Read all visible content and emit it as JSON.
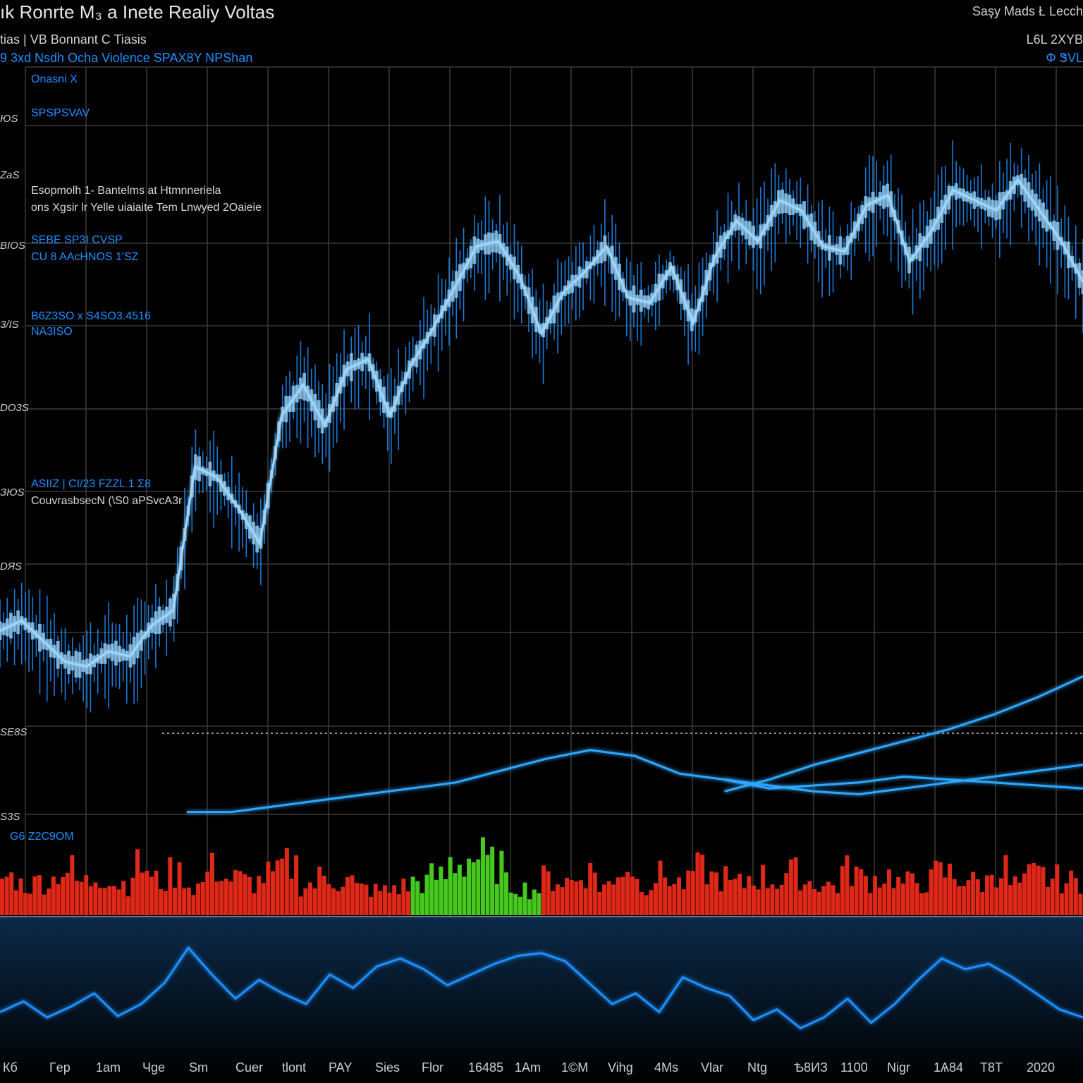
{
  "header": {
    "title": "ık Ronrte M₃ a Inete   Realiy  Voltas",
    "top_right": "Saşy Mads Ł Lecch",
    "line2_left": "tias | VB  Bonnant  C  Tiasis",
    "line2_right": "L6L 2XYB",
    "line3_left": "9 3xd Nsdh Ocha Violence SPAX8Y  NPShan",
    "line3_right": "Φ ᏕVL"
  },
  "annotations": {
    "a1": "Onasni X",
    "a2": "SPSPSVAV",
    "a3_line1": "Esopmolh 1- Bantelms  at  Htmnneriela",
    "a3_line2": "ons Xgsir  lr  Yelle uiaiaite  Tem Lnwyed 2Oaieie",
    "a4_line1": "SEBE  SP3I  CVSP",
    "a4_line2": "CU 8 AAcHNOS  1'SZ",
    "a5_line1": "B6Z3SO  x  S4SO3.4516",
    "a5_line2": "NA3ISO",
    "a6_line1": "ASIIZ  |  CI/23  FZZL  1 Σ8",
    "a6_line2": "CouvrasbsecN (\\S0 aPSvcA3r",
    "a7": "G6  Z2C9OM"
  },
  "y_ticks_left": [
    "ЮS",
    "ZaS",
    "BIOS",
    "3/IS",
    "DO3S",
    "ЗЮS",
    "DЯS",
    "SE8S",
    "S3S"
  ],
  "x_ticks": [
    "Кб",
    "Гep",
    "1am",
    "Чge",
    "Sm",
    "Cuer",
    "tlont",
    "PAY",
    "Sies",
    "Flor",
    "16485",
    "1Am",
    "1©M",
    "Vihg",
    "4Ms",
    "Vlar",
    "Ntg",
    "Ѣ8ИЗ",
    "1100",
    "Nigr",
    "1Ѧ84",
    "T8T",
    "2020"
  ],
  "colors": {
    "background": "#000000",
    "grid": "#3a3a3a",
    "price": "#1e90ff",
    "price_glow": "#9ed8ff",
    "volume_down": "#e02818",
    "volume_up": "#46c81e",
    "indicator": "#2ea8ff",
    "oscillator": "#1e8fff"
  },
  "chart_data": [
    {
      "type": "line",
      "name": "price",
      "x": [
        0,
        1,
        2,
        3,
        4,
        5,
        6,
        7,
        8,
        9,
        10,
        11,
        12,
        13,
        14,
        15,
        16,
        17,
        18,
        19,
        20,
        21,
        22,
        23,
        24,
        25,
        26,
        27,
        28,
        29,
        30,
        31,
        32,
        33,
        34,
        35,
        36,
        37,
        38,
        39,
        40,
        41,
        42,
        43,
        44,
        45,
        46,
        47,
        48,
        49,
        50
      ],
      "values": [
        20,
        22,
        18,
        14,
        13,
        16,
        15,
        21,
        24,
        52,
        50,
        44,
        37,
        62,
        68,
        60,
        71,
        73,
        62,
        72,
        79,
        87,
        95,
        96,
        89,
        78,
        86,
        90,
        95,
        85,
        84,
        91,
        80,
        93,
        100,
        96,
        104,
        102,
        95,
        94,
        103,
        105,
        92,
        98,
        106,
        104,
        102,
        108,
        102,
        96,
        88
      ],
      "ylim": [
        0,
        130
      ]
    },
    {
      "type": "line",
      "name": "indicator",
      "x": [
        0,
        1,
        2,
        3,
        4,
        5,
        6,
        7,
        8,
        9,
        10,
        11,
        12,
        13,
        14,
        15,
        16,
        17,
        18,
        19,
        20
      ],
      "series": [
        {
          "values": [
            2,
            2,
            4,
            6,
            8,
            10,
            12,
            16,
            20,
            23,
            21,
            15,
            13,
            11,
            9,
            8,
            10,
            12,
            14,
            16,
            18
          ]
        },
        {
          "values": [
            null,
            null,
            null,
            null,
            null,
            null,
            null,
            null,
            null,
            null,
            null,
            null,
            9,
            13,
            18,
            22,
            26,
            30,
            35,
            41,
            48
          ]
        },
        {
          "values": [
            null,
            null,
            null,
            null,
            null,
            null,
            null,
            null,
            null,
            null,
            null,
            null,
            13,
            10,
            11,
            12,
            14,
            13,
            12,
            11,
            10
          ]
        }
      ],
      "ylim": [
        0,
        55
      ]
    },
    {
      "type": "bar",
      "name": "volume",
      "values": [
        34,
        28,
        32,
        41,
        30,
        36,
        29,
        44,
        31,
        38,
        27,
        42,
        33,
        30,
        36,
        45,
        28,
        34,
        31,
        24,
        22,
        26,
        30,
        35,
        48,
        52,
        46,
        28,
        24,
        33,
        31,
        39,
        27,
        44,
        30,
        36,
        29,
        41,
        34,
        28,
        35,
        32,
        38,
        30,
        27,
        40,
        33,
        36,
        29,
        31,
        38,
        34,
        30,
        42,
        28,
        36,
        33,
        30
      ],
      "up_range": [
        22,
        28
      ],
      "ylim": [
        0,
        60
      ]
    },
    {
      "type": "line",
      "name": "oscillator",
      "values": [
        34,
        42,
        30,
        38,
        48,
        31,
        40,
        56,
        82,
        62,
        44,
        58,
        48,
        40,
        62,
        52,
        68,
        74,
        66,
        54,
        62,
        70,
        76,
        78,
        72,
        56,
        40,
        48,
        34,
        60,
        52,
        46,
        28,
        36,
        22,
        30,
        44,
        26,
        40,
        58,
        74,
        66,
        70,
        60,
        48,
        36,
        30
      ],
      "ylim": [
        0,
        100
      ]
    }
  ]
}
